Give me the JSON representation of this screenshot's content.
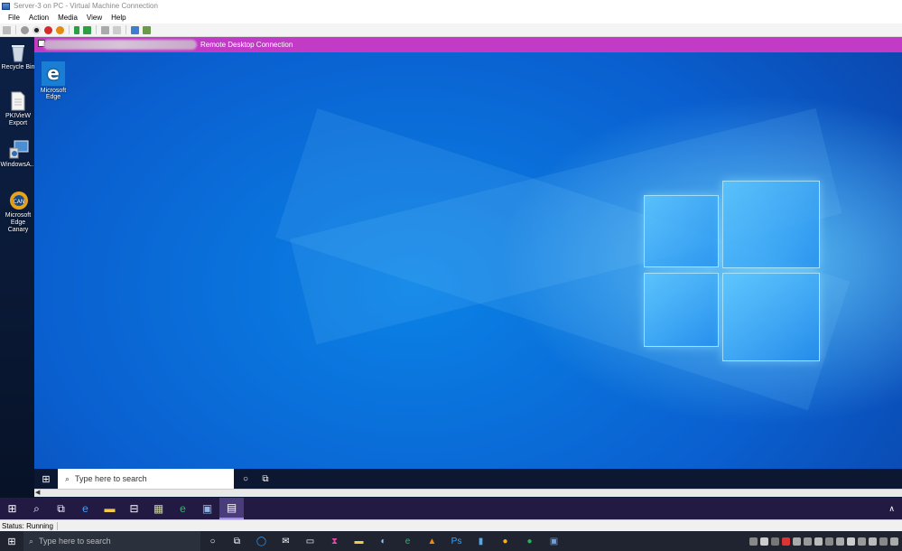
{
  "window": {
    "title": "Server-3 on PC - Virtual Machine Connection"
  },
  "menu": [
    "File",
    "Action",
    "Media",
    "View",
    "Help"
  ],
  "toolbar": {
    "icons": [
      "ctrl-alt-del-icon",
      "start-icon",
      "turn-off-icon",
      "shutdown-icon",
      "save-icon",
      "pause-icon",
      "reset-icon",
      "checkpoint-icon",
      "revert-icon",
      "enhanced-session-icon",
      "share-icon"
    ]
  },
  "host_desktop": {
    "icons": [
      {
        "label": "Recycle Bin",
        "icon": "recycle-bin-icon"
      },
      {
        "label": "PKIVieW Export",
        "icon": "document-icon"
      },
      {
        "label": "WindowsA...",
        "icon": "admin-tools-icon"
      },
      {
        "label": "Microsoft Edge Canary",
        "icon": "edge-canary-icon"
      }
    ]
  },
  "rdc": {
    "title": "Remote Desktop Connection"
  },
  "guest_desktop": {
    "icons": [
      {
        "label": "Microsoft Edge",
        "icon": "edge-icon"
      }
    ]
  },
  "guest_taskbar": {
    "search_placeholder": "Type here to search",
    "icons": [
      "start-icon",
      "search-icon",
      "cortana-icon",
      "task-view-icon"
    ]
  },
  "host_taskbar": {
    "icons": [
      "start-icon",
      "search-icon",
      "task-view-icon",
      "edge-icon",
      "file-explorer-icon",
      "network-icon",
      "folder-icon",
      "edge-beta-icon",
      "rdp-icon",
      "vm-connection-icon"
    ]
  },
  "status": {
    "text": "Status: Running"
  },
  "main_taskbar": {
    "search_placeholder": "Type here to search",
    "icons": [
      "start-icon",
      "cortana-icon",
      "task-view-icon",
      "cortana-ring-icon",
      "mail-icon",
      "store-icon",
      "hourglass-icon",
      "folder-icon",
      "steam-icon",
      "edge-icon",
      "vlc-icon",
      "photoshop-icon",
      "app-icon",
      "paint-icon",
      "spotify-icon",
      "vm-icon"
    ]
  },
  "colors": {
    "rdc_bar": "#c13bc6",
    "desktop_blue": "#0a6fe0",
    "host_taskbar": "#231a44"
  }
}
